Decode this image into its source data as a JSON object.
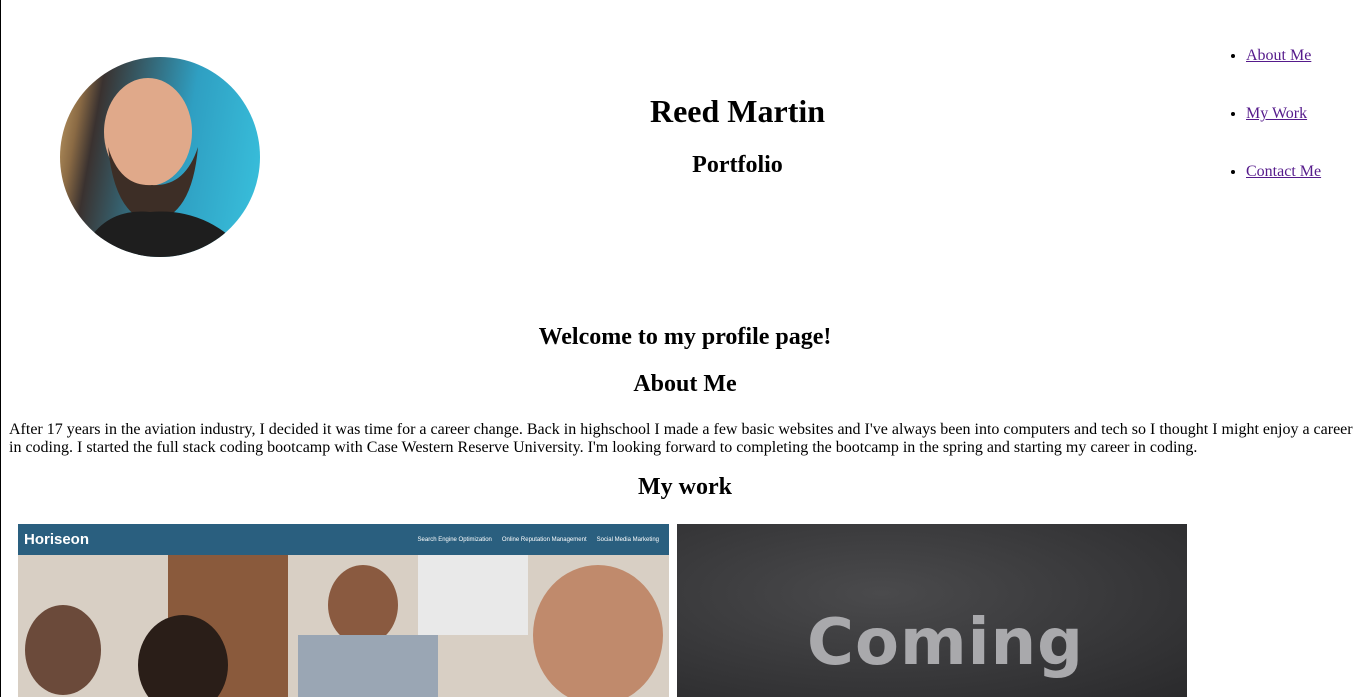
{
  "header": {
    "title": "Reed Martin",
    "subtitle": "Portfolio"
  },
  "nav": {
    "items": [
      {
        "label": "About Me"
      },
      {
        "label": "My Work"
      },
      {
        "label": "Contact Me"
      }
    ]
  },
  "main": {
    "welcome": "Welcome to my profile page!",
    "about_title": "About Me",
    "about_text": "After 17 years in the aviation industry, I decided it was time for a career change. Back in highschool I made a few basic websites and I've always been into computers and tech so I thought I might enjoy a career in coding. I started the full stack coding bootcamp with Case Western Reserve University. I'm looking forward to completing the bootcamp in the spring and starting my career in coding.",
    "work_title": "My work"
  },
  "projects": {
    "horiseon": {
      "brand": "Horiseon",
      "nav": [
        "Search Engine Optimization",
        "Online Reputation Management",
        "Social Media Marketing"
      ]
    },
    "coming_soon": {
      "text": "Coming"
    }
  },
  "colors": {
    "link": "#551a8b",
    "horiseon_bar": "#2a5f7f",
    "chalkboard": "#3a3a3c"
  }
}
